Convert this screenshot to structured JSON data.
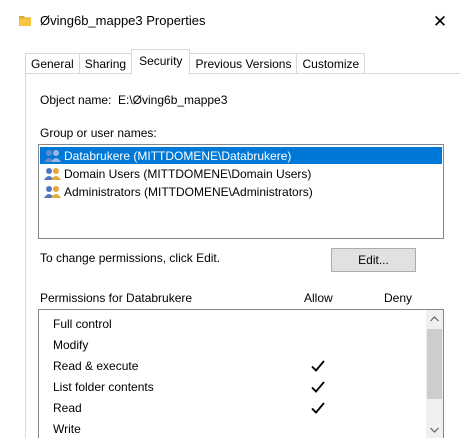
{
  "window": {
    "title": "Øving6b_mappe3 Properties",
    "close_glyph": "✕"
  },
  "tabs": [
    {
      "label": "General",
      "active": false
    },
    {
      "label": "Sharing",
      "active": false
    },
    {
      "label": "Security",
      "active": true
    },
    {
      "label": "Previous Versions",
      "active": false
    },
    {
      "label": "Customize",
      "active": false
    }
  ],
  "security": {
    "object_name_label": "Object name:",
    "object_name_value": "E:\\Øving6b_mappe3",
    "group_label": "Group or user names:",
    "users": [
      {
        "name": "Databrukere (MITTDOMENE\\Databrukere)",
        "selected": true
      },
      {
        "name": "Domain Users (MITTDOMENE\\Domain Users)",
        "selected": false
      },
      {
        "name": "Administrators (MITTDOMENE\\Administrators)",
        "selected": false
      }
    ],
    "change_hint": "To change permissions, click Edit.",
    "edit_button": "Edit...",
    "permissions_header": "Permissions for Databrukere",
    "allow_header": "Allow",
    "deny_header": "Deny",
    "permissions": [
      {
        "name": "Full control",
        "allow": false,
        "deny": false
      },
      {
        "name": "Modify",
        "allow": false,
        "deny": false
      },
      {
        "name": "Read & execute",
        "allow": true,
        "deny": false
      },
      {
        "name": "List folder contents",
        "allow": true,
        "deny": false
      },
      {
        "name": "Read",
        "allow": true,
        "deny": false
      },
      {
        "name": "Write",
        "allow": false,
        "deny": false
      }
    ]
  },
  "colors": {
    "selection": "#0078d7",
    "folder": "#e8b73c"
  }
}
